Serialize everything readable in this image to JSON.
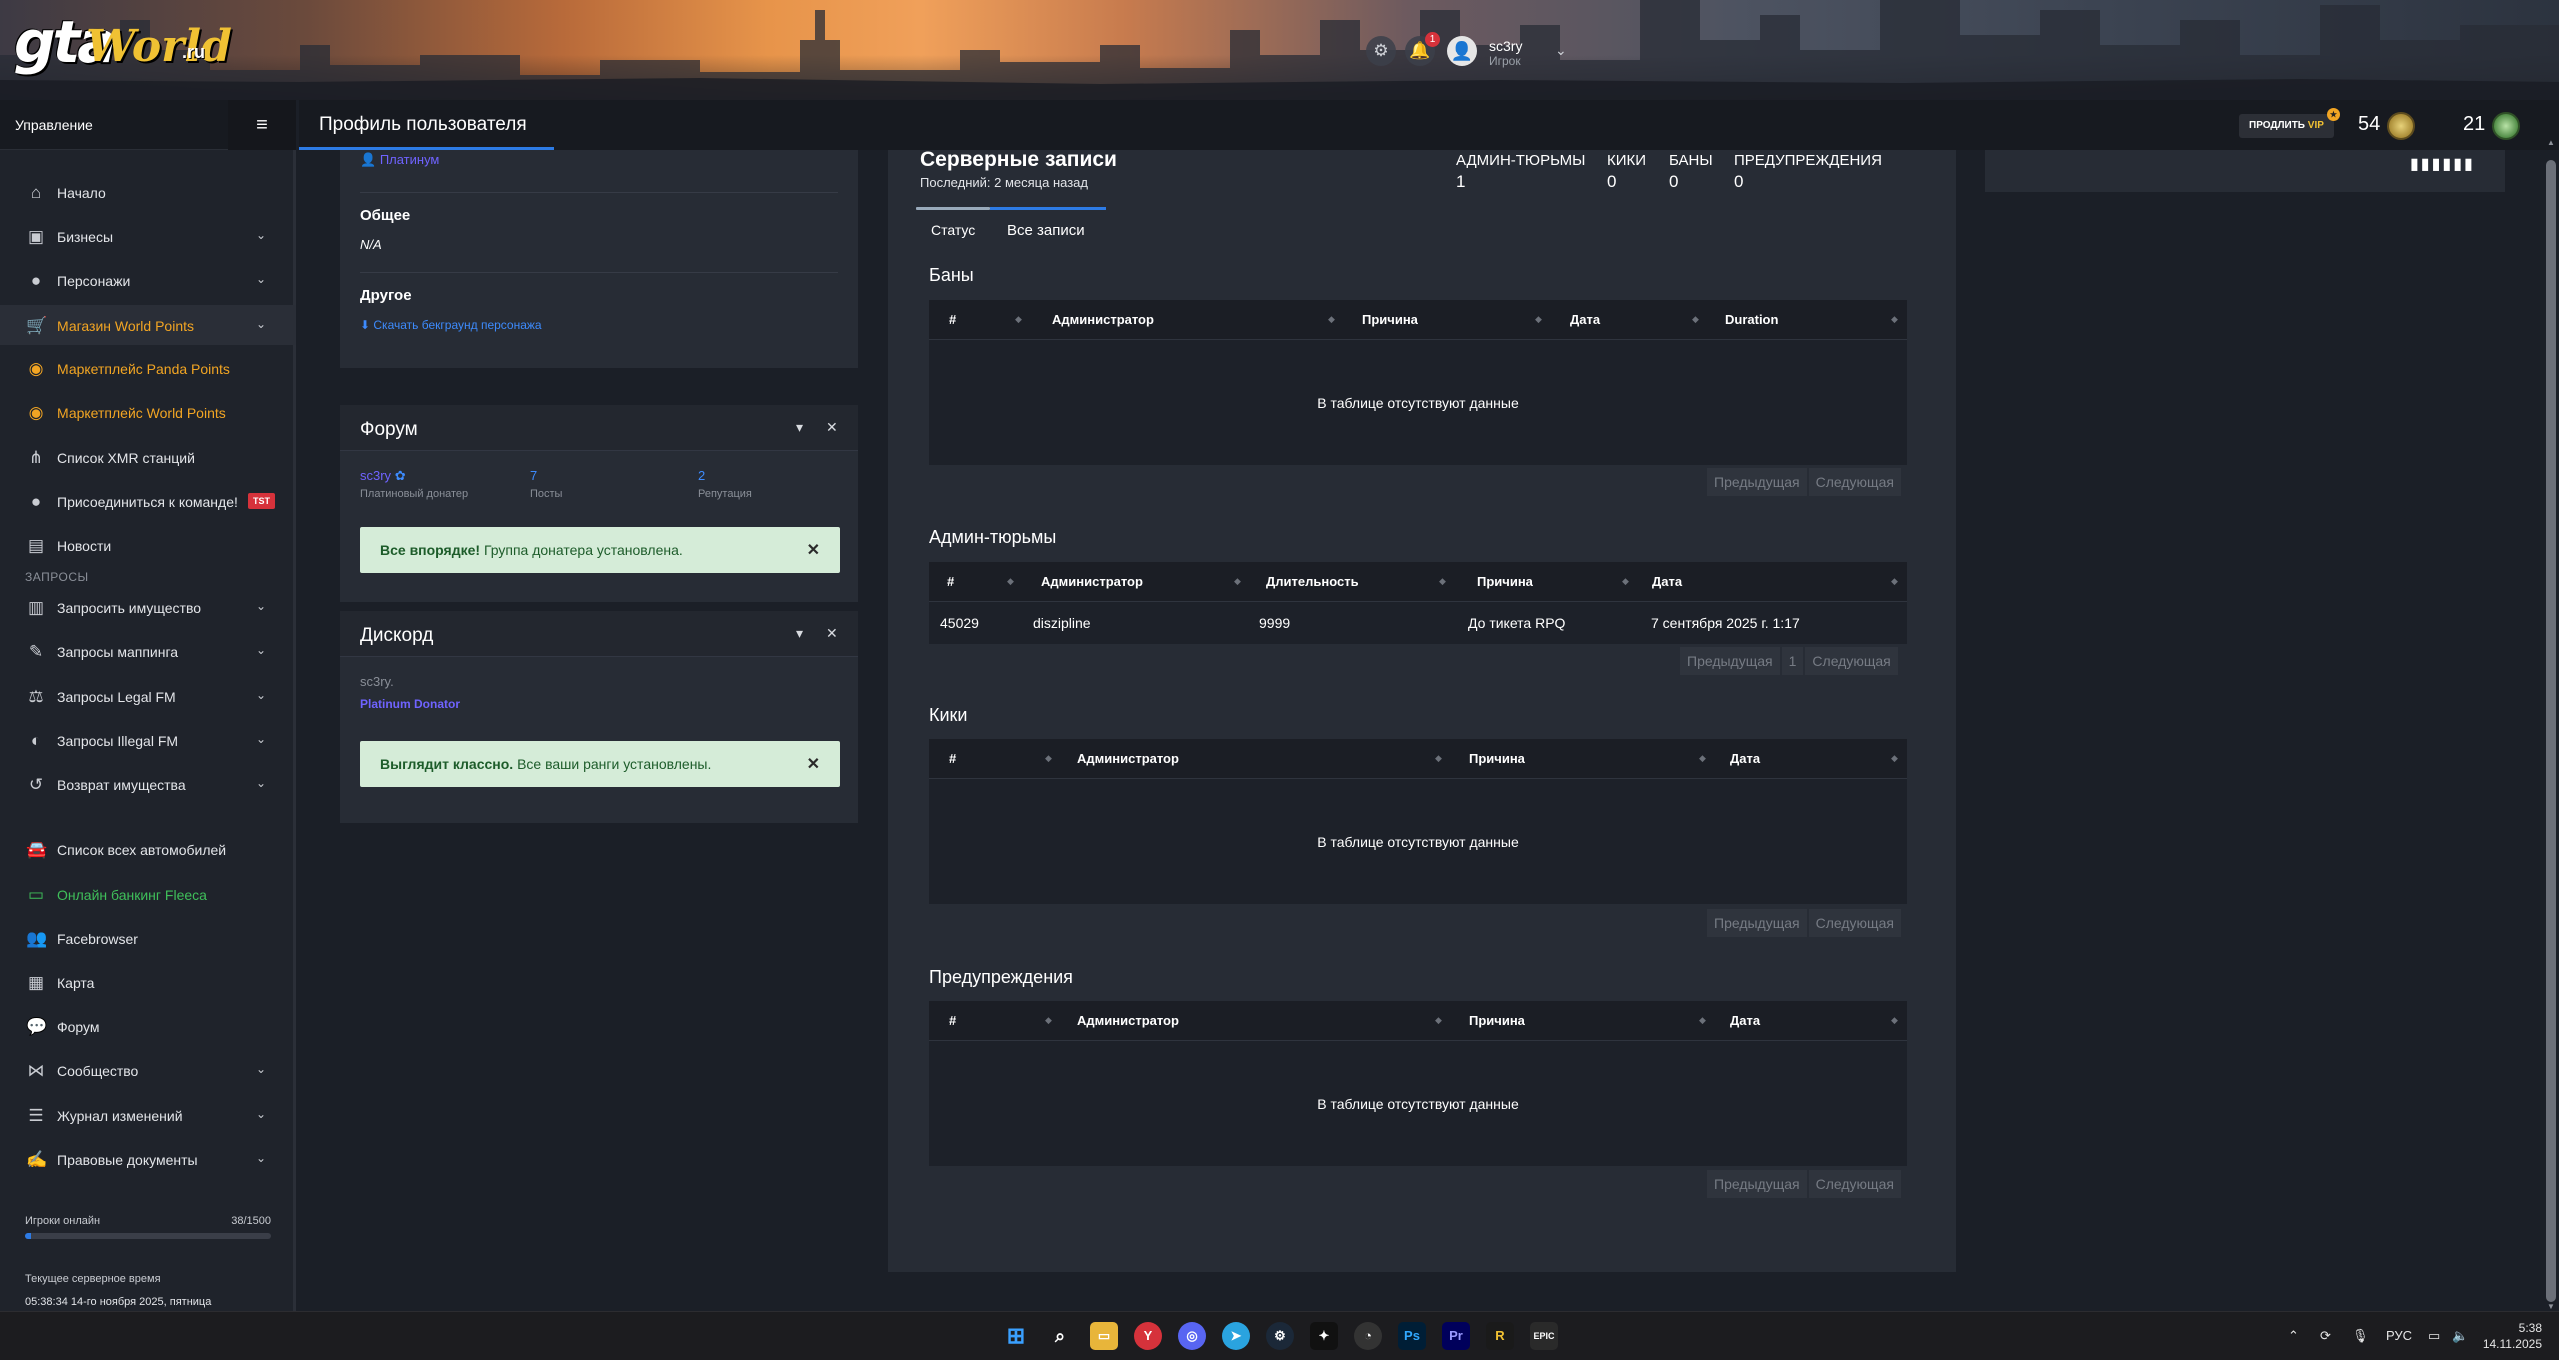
{
  "header": {
    "logo_gta": "gta",
    "logo_world": "World",
    "logo_ru": ".ru",
    "notifications_count": "1",
    "user_name": "sc3ry",
    "user_role": "Игрок"
  },
  "sidebar": {
    "title": "Управление",
    "items": [
      {
        "label": "Начало",
        "icon": "home-icon"
      },
      {
        "label": "Бизнесы",
        "icon": "briefcase-icon"
      },
      {
        "label": "Персонажи",
        "icon": "user-icon"
      },
      {
        "label": "Магазин World Points",
        "icon": "cart-icon"
      },
      {
        "label": "Маркетплейс Panda Points",
        "icon": "coins-icon"
      },
      {
        "label": "Маркетплейс World Points",
        "icon": "coins-icon"
      },
      {
        "label": "Список XMR станций",
        "icon": "antenna-icon"
      },
      {
        "label": "Присоединиться к команде!",
        "icon": "user-tie-icon",
        "badge": "TST"
      },
      {
        "label": "Новости",
        "icon": "newspaper-icon"
      },
      {
        "label": "Запросить имущество",
        "icon": "building-icon"
      },
      {
        "label": "Запросы маппинга",
        "icon": "brush-icon"
      },
      {
        "label": "Запросы Legal FM",
        "icon": "scale-icon"
      },
      {
        "label": "Запросы Illegal FM",
        "icon": "mask-icon"
      },
      {
        "label": "Возврат имущества",
        "icon": "undo-icon"
      },
      {
        "label": "Список всех автомобилей",
        "icon": "car-icon"
      },
      {
        "label": "Онлайн банкинг Fleeca",
        "icon": "money-icon"
      },
      {
        "label": "Facebrowser",
        "icon": "users-icon"
      },
      {
        "label": "Карта",
        "icon": "map-icon"
      },
      {
        "label": "Форум",
        "icon": "comments-icon"
      },
      {
        "label": "Сообщество",
        "icon": "share-icon"
      },
      {
        "label": "Журнал изменений",
        "icon": "list-icon"
      },
      {
        "label": "Правовые документы",
        "icon": "file-signature-icon"
      }
    ],
    "section_requests": "ЗАПРОСЫ",
    "online_label": "Игроки онлайн",
    "online_value": "38/1500",
    "online_fraction": 0.025,
    "server_time_label": "Текущее серверное время",
    "server_time_value": "05:38:34 14-го ноября 2025, пятница"
  },
  "pagebar": {
    "title": "Профиль пользователя",
    "vip_label_a": "ПРОДЛИТЬ ",
    "vip_label_b": "VIP",
    "stat1": "54",
    "stat2": "21"
  },
  "profile_card": {
    "tier_link": "Платинум",
    "general_label": "Общее",
    "general_value": "N/A",
    "other_label": "Другое",
    "download_link": "Скачать бекграунд персонажа"
  },
  "forum_card": {
    "title": "Форум",
    "username": "sc3ry",
    "username_sub": "Платиновый донатер",
    "posts_value": "7",
    "posts_label": "Посты",
    "rep_value": "2",
    "rep_label": "Репутация",
    "alert_bold": "Все впорядке!",
    "alert_text": " Группа донатера установлена."
  },
  "discord_card": {
    "title": "Дискорд",
    "username": "sc3ry.",
    "role": "Platinum Donator",
    "alert_bold": "Выглядит классно.",
    "alert_text": " Все ваши ранги установлены."
  },
  "records": {
    "title": "Серверные записи",
    "last": "Последний: 2 месяца назад",
    "counters": [
      {
        "label": "АДМИН-ТЮРЬМЫ",
        "value": "1"
      },
      {
        "label": "КИКИ",
        "value": "0"
      },
      {
        "label": "БАНЫ",
        "value": "0"
      },
      {
        "label": "ПРЕДУПРЕЖДЕНИЯ",
        "value": "0"
      }
    ],
    "tabs": [
      "Статус",
      "Все записи"
    ],
    "empty_text": "В таблице отсутствуют данные",
    "prev": "Предыдущая",
    "next": "Следующая",
    "page": "1",
    "bans": {
      "title": "Баны",
      "columns": [
        "#",
        "Администратор",
        "Причина",
        "Дата",
        "Duration"
      ]
    },
    "jails": {
      "title": "Админ-тюрьмы",
      "columns": [
        "#",
        "Администратор",
        "Длительность",
        "Причина",
        "Дата"
      ],
      "rows": [
        [
          "45029",
          "diszipline",
          "9999",
          "До тикета RPQ",
          "7 сентября 2025 г. 1:17"
        ]
      ]
    },
    "kicks": {
      "title": "Кики",
      "columns": [
        "#",
        "Администратор",
        "Причина",
        "Дата"
      ]
    },
    "warnings": {
      "title": "Предупреждения",
      "columns": [
        "#",
        "Администратор",
        "Причина",
        "Дата"
      ]
    }
  },
  "taskbar": {
    "lang": "РУС",
    "time": "5:38",
    "date": "14.11.2025"
  },
  "colors": {
    "accent_blue": "#2d7be5",
    "orange": "#f2a523",
    "green": "#3fbf5a",
    "alert_bg": "#d5ecd8"
  }
}
